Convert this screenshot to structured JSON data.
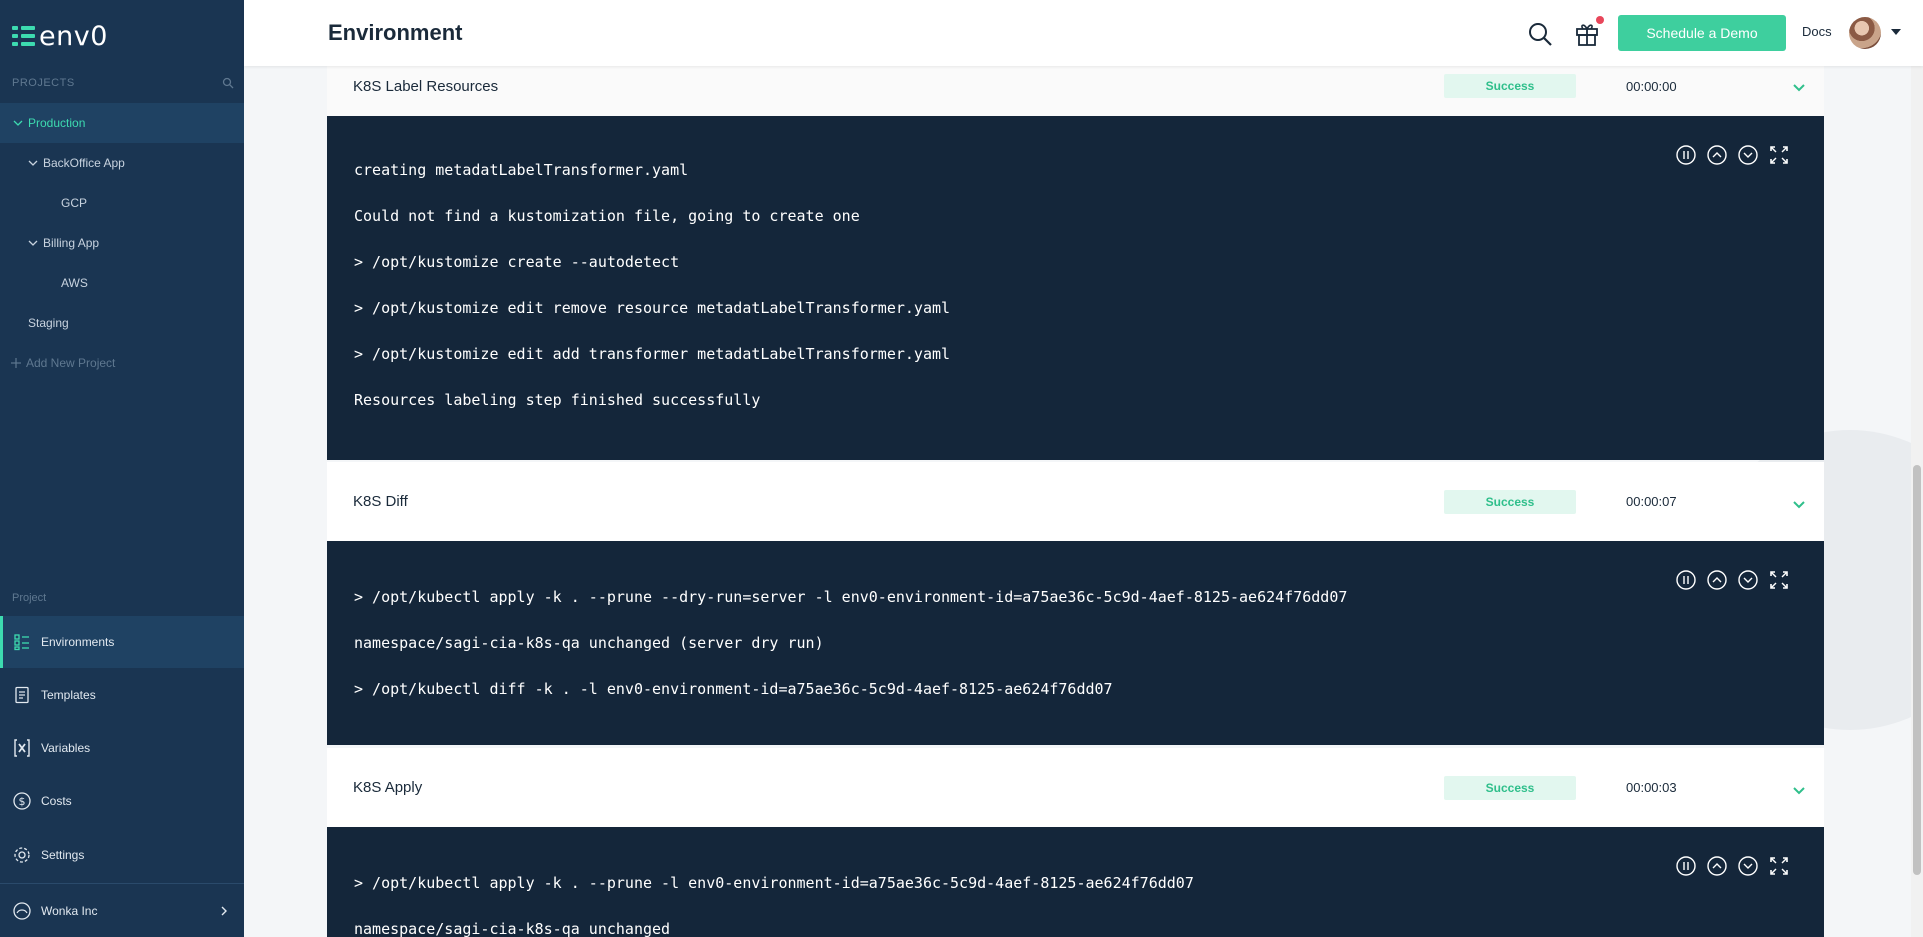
{
  "app": {
    "logo_text": "env0"
  },
  "sidebar": {
    "projects_label": "PROJECTS",
    "tree": [
      {
        "label": "Production",
        "level": 0,
        "expanded": true,
        "active": true
      },
      {
        "label": "BackOffice App",
        "level": 1,
        "expanded": true
      },
      {
        "label": "GCP",
        "level": 2
      },
      {
        "label": "Billing App",
        "level": 1,
        "expanded": true
      },
      {
        "label": "AWS",
        "level": 2
      },
      {
        "label": "Staging",
        "level": 0
      }
    ],
    "add_project_label": "Add New Project",
    "section_label": "Project",
    "nav": [
      {
        "label": "Environments",
        "icon": "environments-icon",
        "active": true
      },
      {
        "label": "Templates",
        "icon": "templates-icon"
      },
      {
        "label": "Variables",
        "icon": "variables-icon"
      },
      {
        "label": "Costs",
        "icon": "costs-icon"
      },
      {
        "label": "Settings",
        "icon": "settings-icon"
      }
    ],
    "org_name": "Wonka Inc"
  },
  "header": {
    "title": "Environment",
    "demo_button": "Schedule a Demo",
    "docs_link": "Docs"
  },
  "steps": [
    {
      "name": "K8S Label Resources",
      "status": "Success",
      "duration": "00:00:00",
      "log": [
        "creating metadatLabelTransformer.yaml",
        "Could not find a kustomization file, going to create one",
        "> /opt/kustomize create --autodetect",
        "> /opt/kustomize edit remove resource metadatLabelTransformer.yaml",
        "> /opt/kustomize edit add transformer metadatLabelTransformer.yaml",
        "Resources labeling step finished successfully"
      ]
    },
    {
      "name": "K8S Diff",
      "status": "Success",
      "duration": "00:00:07",
      "log": [
        "> /opt/kubectl apply -k . --prune --dry-run=server -l env0-environment-id=a75ae36c-5c9d-4aef-8125-ae624f76dd07",
        "namespace/sagi-cia-k8s-qa unchanged (server dry run)",
        "> /opt/kubectl diff -k . -l env0-environment-id=a75ae36c-5c9d-4aef-8125-ae624f76dd07"
      ]
    },
    {
      "name": "K8S Apply",
      "status": "Success",
      "duration": "00:00:03",
      "log": [
        "> /opt/kubectl apply -k . --prune -l env0-environment-id=a75ae36c-5c9d-4aef-8125-ae624f76dd07",
        "namespace/sagi-cia-k8s-qa unchanged"
      ]
    }
  ],
  "colors": {
    "sidebar_bg": "#1a3552",
    "accent": "#3ddbb0",
    "button_green": "#3ecf9e",
    "log_bg": "#14263a",
    "success_bg": "#e2f7ef",
    "success_text": "#2fbf8b"
  }
}
